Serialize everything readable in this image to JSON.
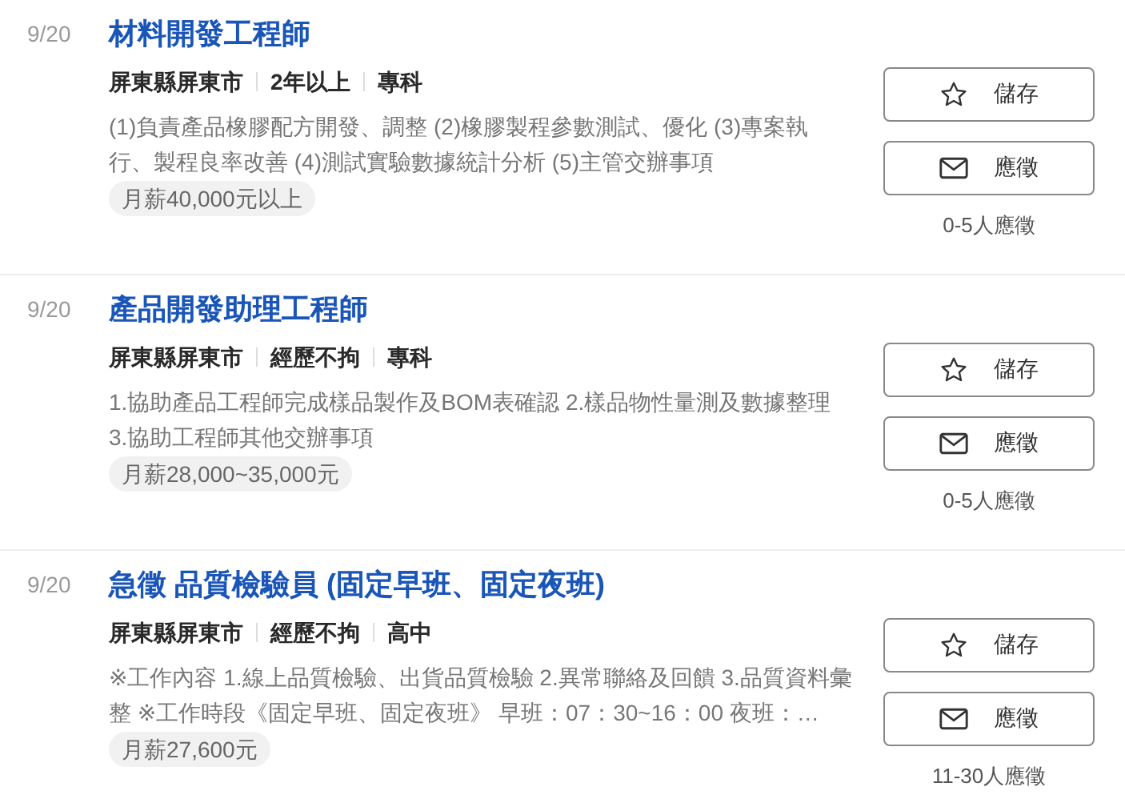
{
  "jobs": [
    {
      "date": "9/20",
      "title": "材料開發工程師",
      "meta": [
        "屏東縣屏東市",
        "2年以上",
        "專科"
      ],
      "description": "(1)負責產品橡膠配方開發、調整 (2)橡膠製程參數測試、優化 (3)專案執行、製程良率改善 (4)測試實驗數據統計分析 (5)主管交辦事項",
      "salary": "月薪40,000元以上",
      "save_label": "儲存",
      "apply_label": "應徵",
      "applicants": "0-5人應徵"
    },
    {
      "date": "9/20",
      "title": "產品開發助理工程師",
      "meta": [
        "屏東縣屏東市",
        "經歷不拘",
        "專科"
      ],
      "description": "1.協助產品工程師完成樣品製作及BOM表確認 2.樣品物性量測及數據整理 3.協助工程師其他交辦事項",
      "salary": "月薪28,000~35,000元",
      "save_label": "儲存",
      "apply_label": "應徵",
      "applicants": "0-5人應徵"
    },
    {
      "date": "9/20",
      "title": "急徵 品質檢驗員 (固定早班、固定夜班)",
      "meta": [
        "屏東縣屏東市",
        "經歷不拘",
        "高中"
      ],
      "description": "※工作內容 1.線上品質檢驗、出貨品質檢驗 2.異常聯絡及回饋 3.品質資料彙整 ※工作時段《固定早班、固定夜班》 早班：07：30~16：00 夜班：…",
      "salary": "月薪27,600元",
      "save_label": "儲存",
      "apply_label": "應徵",
      "applicants": "11-30人應徵"
    }
  ]
}
